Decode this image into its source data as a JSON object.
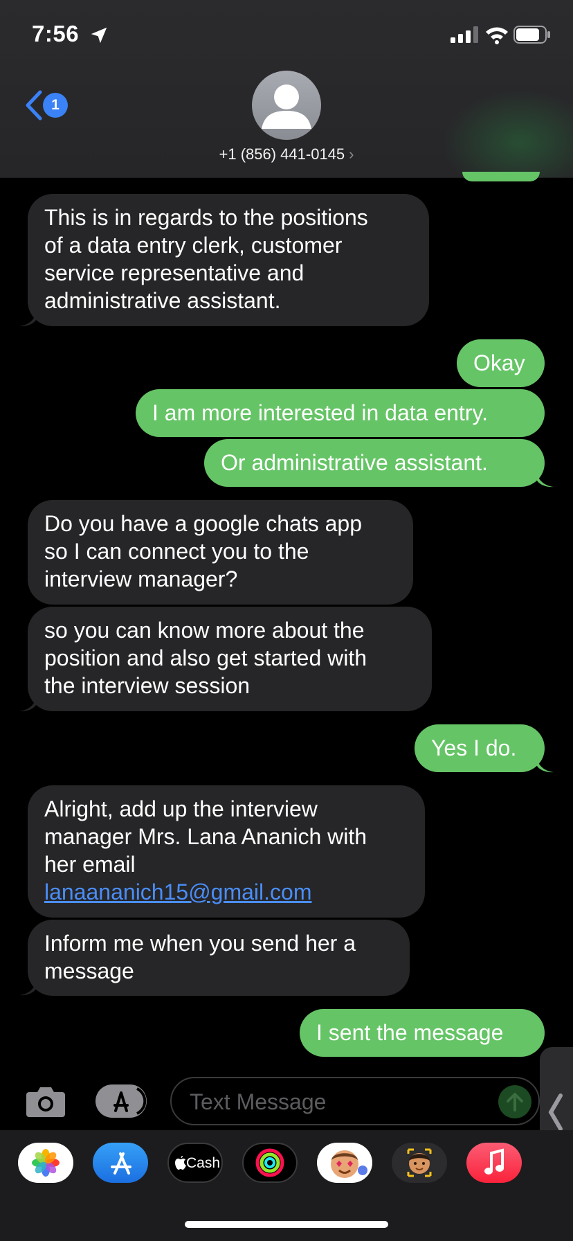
{
  "status_bar": {
    "time": "7:56"
  },
  "header": {
    "back_badge": "1",
    "contact": "+1 (856) 441-0145",
    "contact_chevron": "›"
  },
  "messages": [
    {
      "dir": "in",
      "lines": [
        "This is in regards to the positions",
        "of a data entry clerk, customer",
        "service representative and",
        "administrative assistant."
      ]
    },
    {
      "dir": "out",
      "lines": [
        "Okay"
      ]
    },
    {
      "dir": "out",
      "lines": [
        "I am more interested in data entry."
      ]
    },
    {
      "dir": "out",
      "lines": [
        "Or administrative assistant."
      ]
    },
    {
      "dir": "in",
      "lines": [
        "Do you have a google chats app",
        "so I can connect you to the",
        "interview manager?"
      ]
    },
    {
      "dir": "in",
      "lines": [
        "so you can know more about the",
        "position and also get started with",
        "the interview session"
      ]
    },
    {
      "dir": "out",
      "lines": [
        "Yes I do."
      ]
    },
    {
      "dir": "in",
      "lines": [
        "Alright, add up the interview",
        "manager Mrs. Lana Ananich with",
        "her email"
      ],
      "link": "lanaananich15@gmail.com"
    },
    {
      "dir": "in",
      "lines": [
        "Inform me when you send her a",
        "message"
      ]
    },
    {
      "dir": "out",
      "lines": [
        "I sent the message"
      ]
    }
  ],
  "input": {
    "placeholder": "Text Message"
  },
  "app_strip": {
    "apps": [
      "photos-icon",
      "app-store-icon",
      "apple-cash-icon",
      "activity-icon",
      "memoji-stickers-icon",
      "memoji-icon",
      "music-icon"
    ],
    "cash_label": "Cash"
  },
  "colors": {
    "incoming": "#262628",
    "outgoing": "#65c466",
    "link": "#4a8df7",
    "badge": "#3a82f6"
  }
}
